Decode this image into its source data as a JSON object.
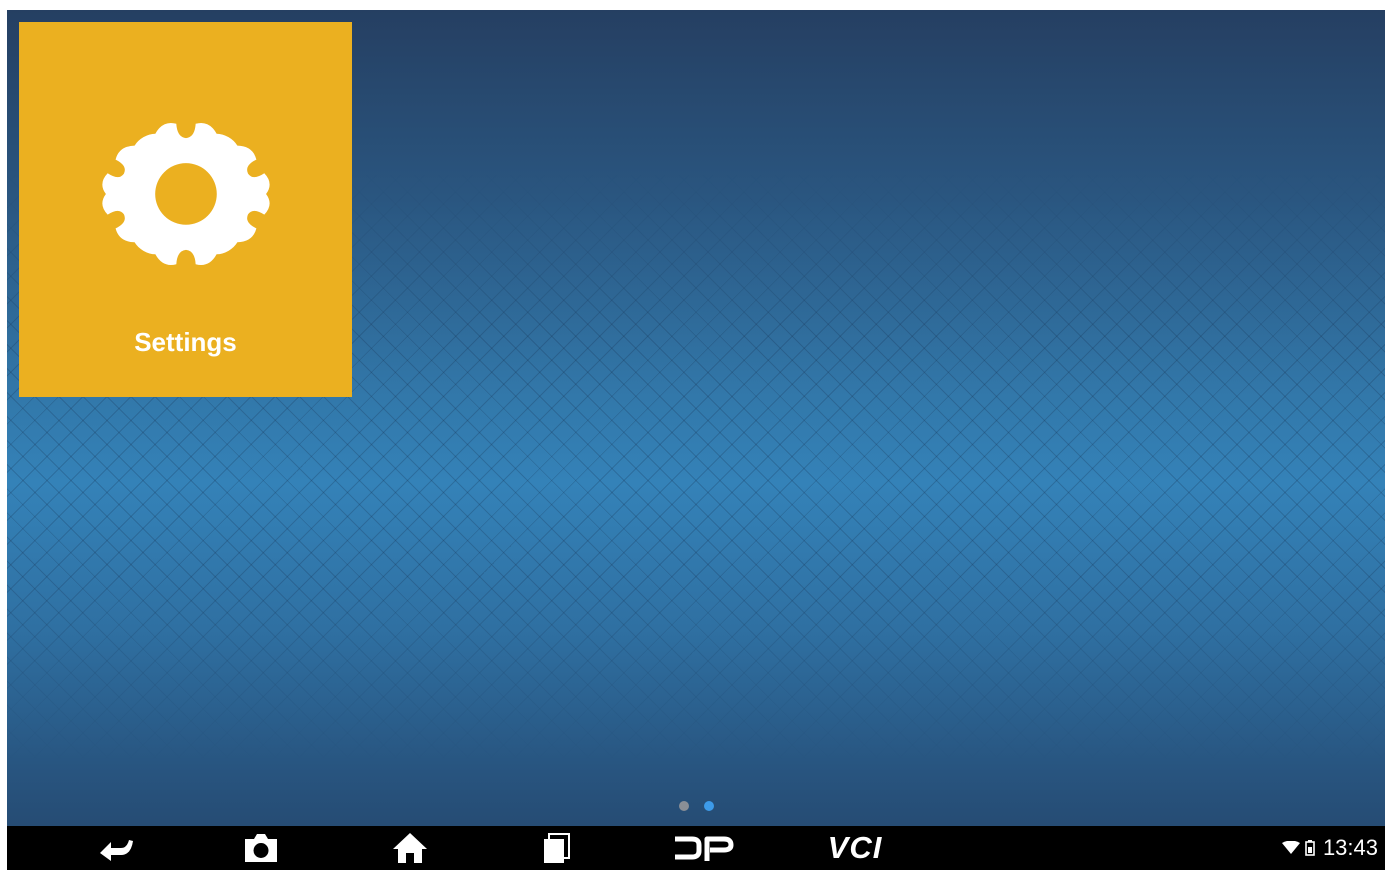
{
  "home": {
    "tiles": [
      {
        "label": "Settings",
        "icon": "gear-icon",
        "color": "#ebb020"
      }
    ],
    "pager": {
      "pages": 2,
      "current": 2,
      "active_color": "#3d9be9",
      "inactive_color": "#8a8f96"
    }
  },
  "navbar": {
    "buttons": [
      {
        "name": "back-button",
        "icon": "back-arrow-icon"
      },
      {
        "name": "screenshot-button",
        "icon": "camera-icon"
      },
      {
        "name": "home-button",
        "icon": "home-icon"
      },
      {
        "name": "recent-apps-button",
        "icon": "recent-apps-icon"
      },
      {
        "name": "dp-button",
        "icon": "dp-logo-icon"
      },
      {
        "name": "vci-button",
        "label": "VCI"
      }
    ],
    "status": {
      "wifi_icon": "wifi-icon",
      "battery_icon": "battery-icon",
      "time": "13:43"
    }
  }
}
